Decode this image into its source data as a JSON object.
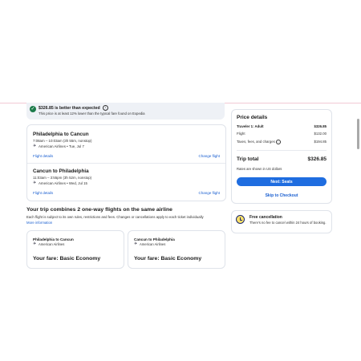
{
  "banner": {
    "title": "$326.85 is better than expected",
    "subtitle": "This price is at least 12% lower than the typical fare found on Expedia"
  },
  "flights": [
    {
      "title": "Philadelphia to Cancun",
      "times": "7:08am – 10:03am (3h 55m, nonstop)",
      "airline_date": "American Airlines • Tue, Jul 7",
      "details_link": "Flight details",
      "change_link": "Change flight"
    },
    {
      "title": "Cancun to Philadelphia",
      "times": "11:03am – 3:55pm (3h 52m, nonstop)",
      "airline_date": "American Airlines • Wed, Jul 15",
      "details_link": "Flight details",
      "change_link": "Change flight"
    }
  ],
  "combine": {
    "title": "Your trip combines 2 one-way flights on the same airline",
    "subtitle": "Each flight is subject to its own rules, restrictions and fees. Changes or cancellations apply to each ticket individually",
    "more_info": "More information"
  },
  "fare_cards": [
    {
      "route": "Philadelphia to Cancun",
      "airline": "American Airlines",
      "fare": "Your fare: Basic Economy"
    },
    {
      "route": "Cancun to Philadelphia",
      "airline": "American Airlines",
      "fare": "Your fare: Basic Economy"
    }
  ],
  "price": {
    "title": "Price details",
    "traveler_label": "Traveler 1: Adult",
    "traveler_value": "$326.85",
    "flight_label": "Flight",
    "flight_value": "$132.00",
    "taxes_label": "Taxes, fees, and charges",
    "taxes_value": "$194.85",
    "total_label": "Trip total",
    "total_value": "$326.85",
    "rates_note": "Rates are shown in US dollars",
    "next_button": "Next: Seats",
    "skip_link": "Skip to Checkout"
  },
  "cancellation": {
    "title": "Free cancellation",
    "description": "There's no fee to cancel within 24 hours of booking."
  }
}
